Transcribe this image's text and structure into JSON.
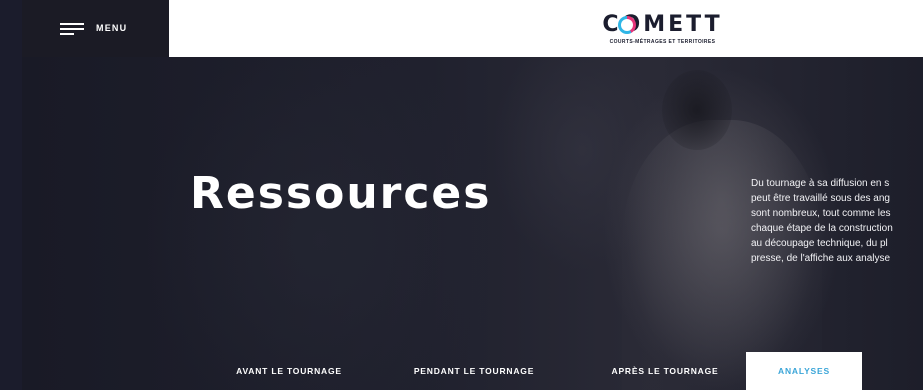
{
  "nav": {
    "menu_label": "MENU",
    "menu_icon": "hamburger-icon"
  },
  "brand": {
    "name": "COMETT",
    "tagline": "COURTS-MÉTRAGES ET TERRITOIRES",
    "accent_pink": "#e7357a",
    "accent_blue": "#2fb6e6"
  },
  "hero": {
    "title": "Ressources",
    "intro_lines": [
      "Du tournage à sa diffusion en s",
      "peut être travaillé sous des ang",
      "sont nombreux, tout comme les",
      "chaque étape de la construction",
      "au découpage technique, du pl",
      "presse, de l'affiche aux analyse"
    ]
  },
  "tabs": [
    {
      "label": "AVANT LE TOURNAGE",
      "active": false
    },
    {
      "label": "PENDANT LE TOURNAGE",
      "active": false
    },
    {
      "label": "APRÈS LE TOURNAGE",
      "active": false
    },
    {
      "label": "ANALYSES",
      "active": true
    }
  ],
  "colors": {
    "dark_bg": "#1c1d2b",
    "active_tab_text": "#3aa5d8"
  }
}
